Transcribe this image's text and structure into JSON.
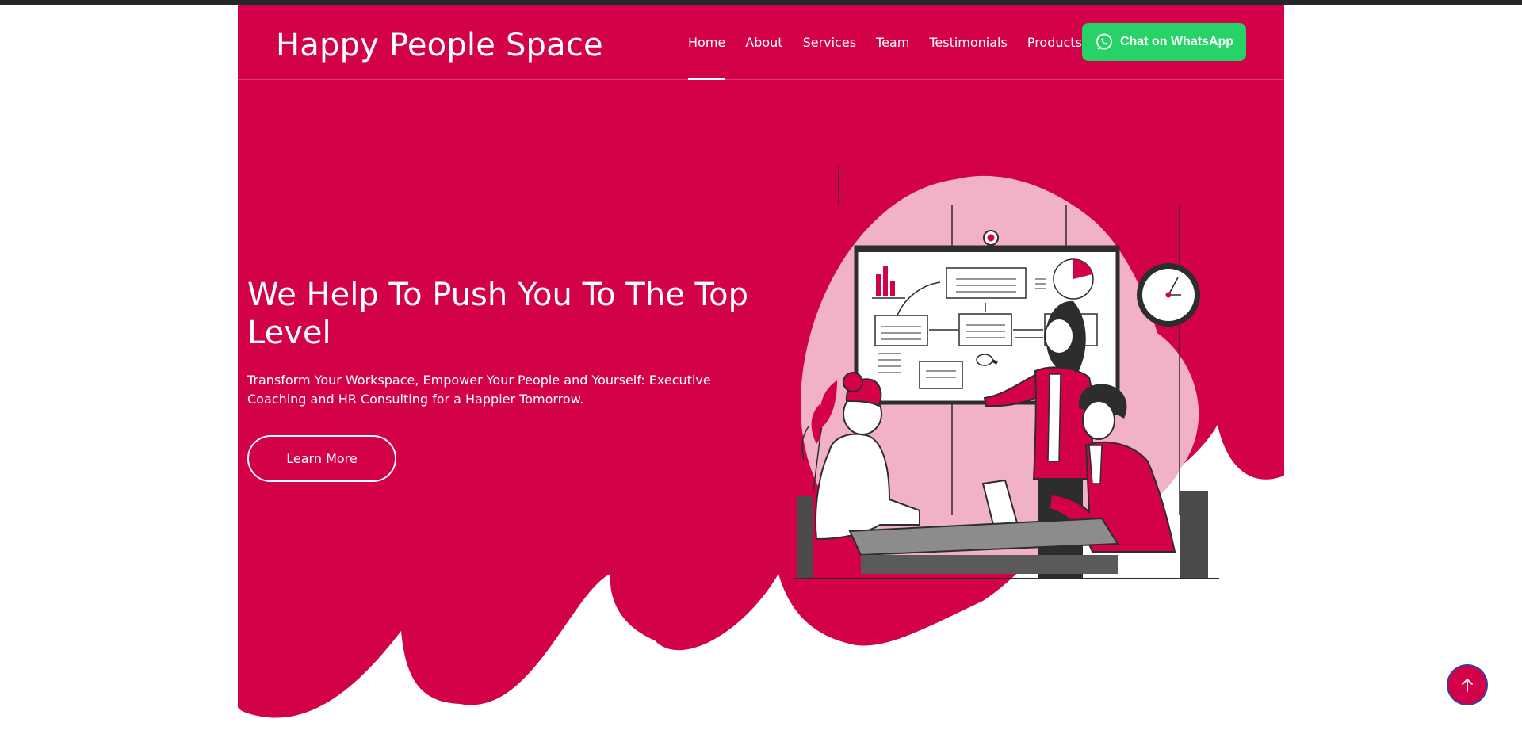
{
  "brand": {
    "name": "Happy People Space"
  },
  "nav": {
    "items": [
      {
        "label": "Home",
        "active": true
      },
      {
        "label": "About"
      },
      {
        "label": "Services"
      },
      {
        "label": "Team"
      },
      {
        "label": "Testimonials"
      },
      {
        "label": "Products",
        "has_dropdown": true
      }
    ]
  },
  "whatsapp": {
    "label": "Chat on WhatsApp",
    "icon": "whatsapp-icon"
  },
  "hero": {
    "title": "We Help To Push You To The Top Level",
    "text": "Transform Your Workspace, Empower Your People and Yourself: Executive Coaching and HR Consulting for a Happier Tomorrow.",
    "button_label": "Learn More"
  },
  "back_to_top": {
    "icon": "arrow-up-icon"
  },
  "colors": {
    "brand": "#d3004a",
    "whatsapp": "#25d366",
    "topbar": "#23272b",
    "illustration_bg": "#f0b1c9"
  }
}
